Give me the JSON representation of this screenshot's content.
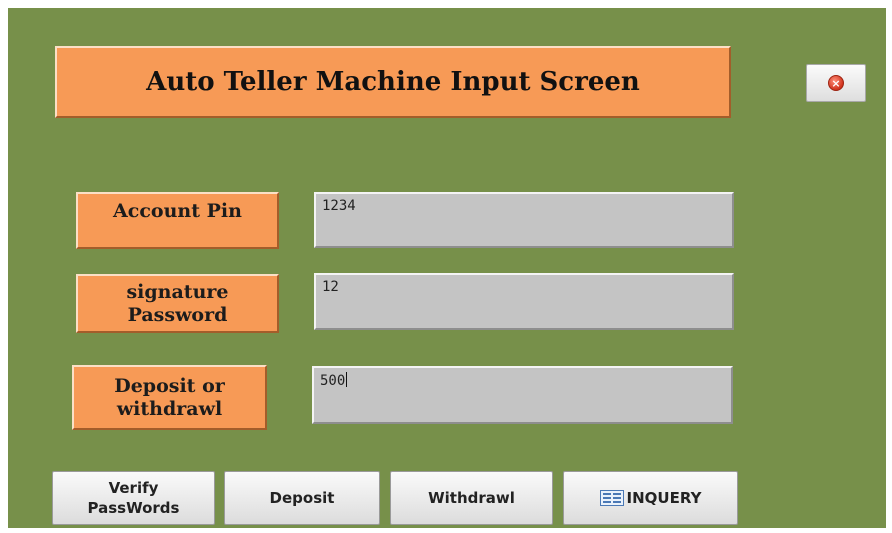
{
  "window": {
    "title": "Auto Teller Machine Input Screen"
  },
  "colors": {
    "background": "#77904a",
    "label_fill": "#f79a56",
    "field_fill": "#c4c4c4",
    "button_fill": "#e6e6e6"
  },
  "icons": {
    "close": "close-icon",
    "inquery": "table-icon"
  },
  "fields": {
    "account_pin": {
      "label": "Account Pin",
      "value": "1234"
    },
    "signature_password": {
      "label": "signature Password",
      "value": "12"
    },
    "deposit_or_withdrawl": {
      "label": "Deposit or withdrawl",
      "value": "500"
    }
  },
  "buttons": {
    "verify": "Verify PassWords",
    "deposit": "Deposit",
    "withdrawl": "Withdrawl",
    "inquery": "INQUERY"
  }
}
